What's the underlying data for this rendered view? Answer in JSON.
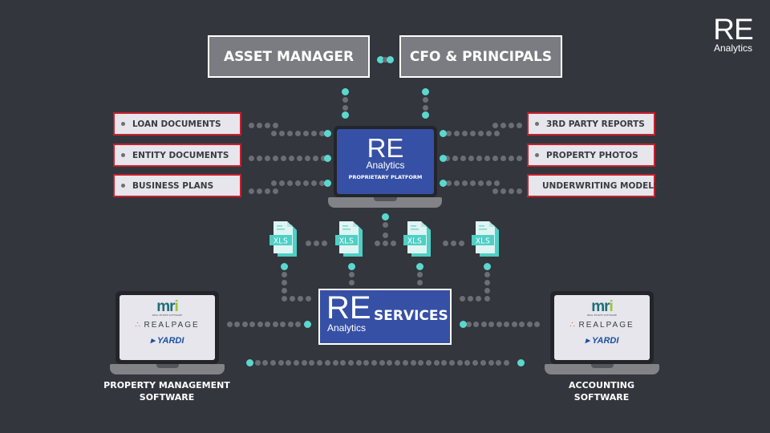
{
  "logo": {
    "main": "RE",
    "sub": "Analytics"
  },
  "roles": [
    {
      "label": "ASSET MANAGER"
    },
    {
      "label": "CFO & PRINCIPALS"
    }
  ],
  "left_documents": [
    {
      "label": "LOAN DOCUMENTS"
    },
    {
      "label": "ENTITY DOCUMENTS"
    },
    {
      "label": "BUSINESS PLANS"
    }
  ],
  "right_documents": [
    {
      "label": "3RD PARTY REPORTS"
    },
    {
      "label": "PROPERTY PHOTOS"
    },
    {
      "label": "UNDERWRITING MODELS"
    }
  ],
  "platform": {
    "main": "RE",
    "sub": "Analytics",
    "caption": "PROPRIETARY PLATFORM"
  },
  "xls_files": [
    {
      "label": "XLS"
    },
    {
      "label": "XLS"
    },
    {
      "label": "XLS"
    },
    {
      "label": "XLS"
    }
  ],
  "services": {
    "main": "RE",
    "sub": "Analytics",
    "label": "SERVICES"
  },
  "software": [
    {
      "caption_line1": "PROPERTY MANAGEMENT",
      "caption_line2": "SOFTWARE",
      "brands": {
        "mri": "mr",
        "mri_i": "i",
        "mri_sub": "REAL ESTATE SOFTWARE",
        "realpage": "REALPAGE",
        "realpage_dots": "∴",
        "yardi": "YARDI"
      }
    },
    {
      "caption_line1": "ACCOUNTING",
      "caption_line2": "SOFTWARE",
      "brands": {
        "mri": "mr",
        "mri_i": "i",
        "mri_sub": "REAL ESTATE SOFTWARE",
        "realpage": "REALPAGE",
        "realpage_dots": "∴",
        "yardi": "YARDI"
      }
    }
  ],
  "colors": {
    "background": "#33363d",
    "accent_teal": "#5ad8cf",
    "platform_blue": "#3650a6",
    "doc_border_red": "#c8202e",
    "role_gray": "#7b7c81"
  }
}
